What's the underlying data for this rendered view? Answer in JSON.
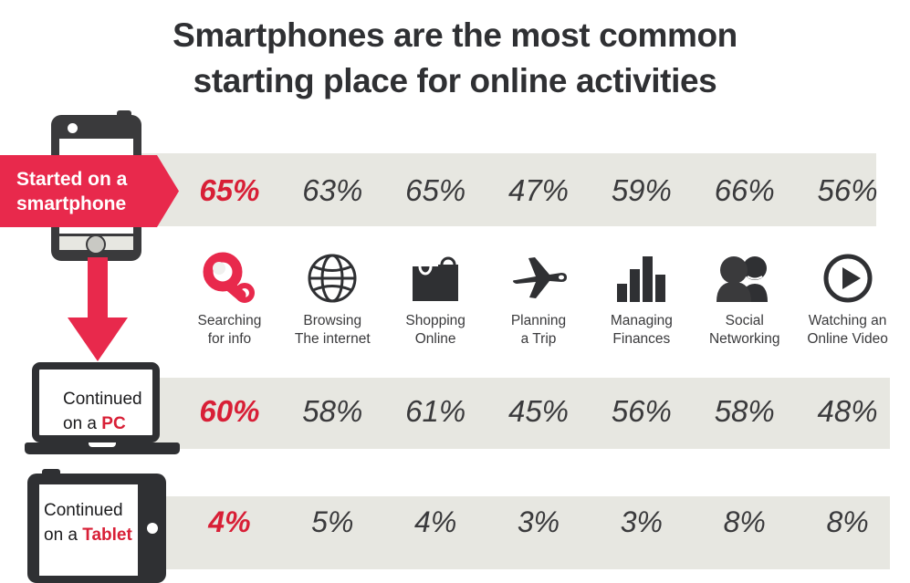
{
  "title": {
    "line1": "Smartphones are the most common",
    "line2": "starting place for online activities"
  },
  "colors": {
    "accent_red": "#d81f36",
    "banner_red": "#e8294c",
    "band_gray": "#e7e7e1",
    "dark": "#3a3a3c"
  },
  "banner": {
    "line1": "Started on a",
    "line2": "smartphone"
  },
  "devices": {
    "phone": {
      "name": "smartphone"
    },
    "laptop": {
      "line1": "Continued",
      "line2_prefix": "on a ",
      "line2_accent": "PC"
    },
    "tablet": {
      "line1": "Continued",
      "line2_prefix": "on a ",
      "line2_accent": "Tablet"
    }
  },
  "activities": [
    {
      "icon": "magnifier-icon",
      "label_line1": "Searching",
      "label_line2": "for info"
    },
    {
      "icon": "globe-icon",
      "label_line1": "Browsing",
      "label_line2": "The internet"
    },
    {
      "icon": "shopping-bag-icon",
      "label_line1": "Shopping",
      "label_line2": "Online"
    },
    {
      "icon": "airplane-icon",
      "label_line1": "Planning",
      "label_line2": "a Trip"
    },
    {
      "icon": "bar-chart-icon",
      "label_line1": "Managing",
      "label_line2": "Finances"
    },
    {
      "icon": "people-icon",
      "label_line1": "Social",
      "label_line2": "Networking"
    },
    {
      "icon": "play-circle-icon",
      "label_line1": "Watching an",
      "label_line2": "Online Video"
    }
  ],
  "chart_data": {
    "type": "table",
    "title": "Smartphones are the most common starting place for online activities",
    "categories": [
      "Searching for info",
      "Browsing The internet",
      "Shopping Online",
      "Planning a Trip",
      "Managing Finances",
      "Social Networking",
      "Watching an Online Video"
    ],
    "series": [
      {
        "name": "Started on a smartphone",
        "values": [
          65,
          63,
          65,
          47,
          59,
          66,
          56
        ],
        "unit": "%"
      },
      {
        "name": "Continued on a PC",
        "values": [
          60,
          58,
          61,
          45,
          56,
          58,
          48
        ],
        "unit": "%"
      },
      {
        "name": "Continued on a Tablet",
        "values": [
          4,
          5,
          4,
          3,
          3,
          8,
          8
        ],
        "unit": "%"
      }
    ],
    "highlight_column_index": 0,
    "xlabel": "",
    "ylabel": "",
    "grid": false,
    "legend": "row-labels-left"
  },
  "rows": {
    "smartphone": [
      "65%",
      "63%",
      "65%",
      "47%",
      "59%",
      "66%",
      "56%"
    ],
    "pc": [
      "60%",
      "58%",
      "61%",
      "45%",
      "56%",
      "58%",
      "48%"
    ],
    "tablet": [
      "4%",
      "5%",
      "4%",
      "3%",
      "3%",
      "8%",
      "8%"
    ]
  }
}
